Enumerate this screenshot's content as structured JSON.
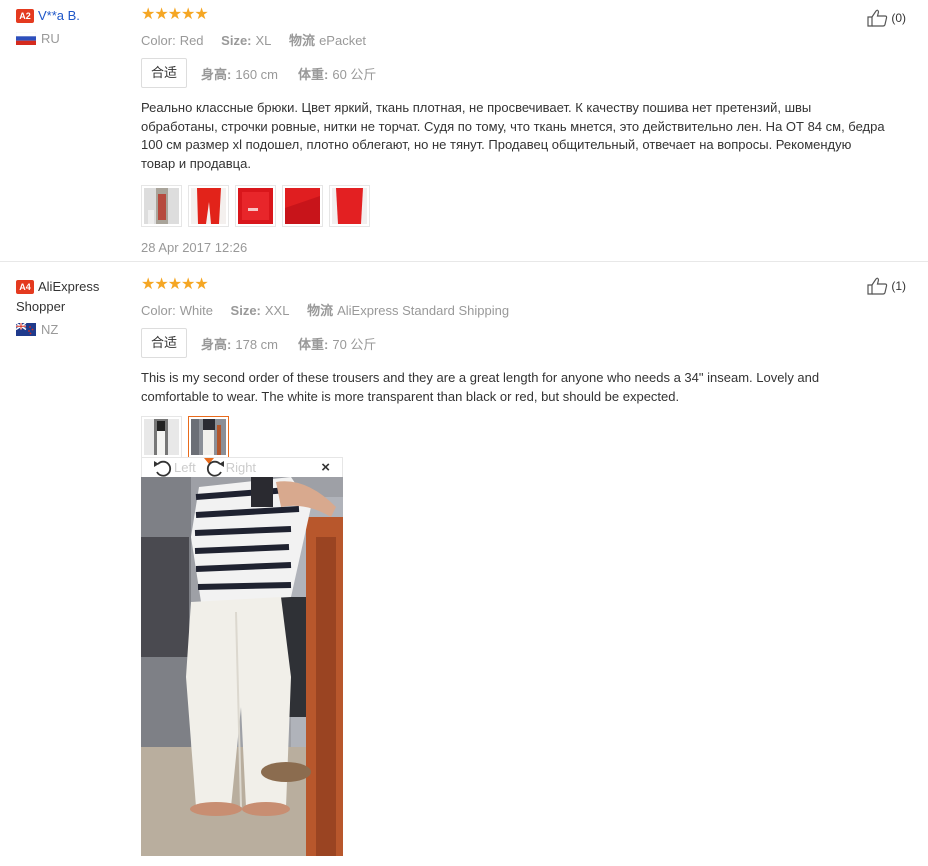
{
  "reviews": [
    {
      "user": {
        "level": "A2",
        "name": "V**a B.",
        "country": "RU"
      },
      "stars": "★★★★★",
      "rating": 5,
      "meta": {
        "color_label": "Color:",
        "color": "Red",
        "size_label": "Size:",
        "size": "XL",
        "ship_label": "物流",
        "ship": "ePacket"
      },
      "fit": {
        "tag": "合适",
        "height_label": "身高:",
        "height": "160 cm",
        "weight_label": "体重:",
        "weight": "60 公斤"
      },
      "text": "Реально классные брюки. Цвет яркий, ткань плотная, не просвечивает. К качеству пошива нет претензий, швы обработаны, строчки ровные, нитки не торчат. Судя по тому, что ткань мнется, это действительно лен. На ОТ 84 см, бедра 100 см размер xl подошел, плотно облегают, но не тянут. Продавец общительный, отвечает на вопросы. Рекомендую товар и продавца.",
      "date": "28 Apr 2017 12:26",
      "helpful": "(0)"
    },
    {
      "user": {
        "level": "A4",
        "name": "AliExpress Shopper",
        "country": "NZ"
      },
      "stars": "★★★★★",
      "rating": 5,
      "meta": {
        "color_label": "Color:",
        "color": "White",
        "size_label": "Size:",
        "size": "XXL",
        "ship_label": "物流",
        "ship": "AliExpress Standard Shipping"
      },
      "fit": {
        "tag": "合适",
        "height_label": "身高:",
        "height": "178 cm",
        "weight_label": "体重:",
        "weight": "70 公斤"
      },
      "text": "This is my second order of these trousers and they are a great length for anyone who needs a 34\" inseam. Lovely and comfortable to wear. The white is more transparent than black or red, but should be expected.",
      "helpful": "(1)"
    }
  ],
  "viewer": {
    "left_label": "Left",
    "right_label": "Right",
    "close": "×"
  },
  "colors": {
    "accent": "#e43a1f",
    "link": "#1f57c8",
    "star": "#f5a623",
    "active_border": "#e86b1c"
  }
}
